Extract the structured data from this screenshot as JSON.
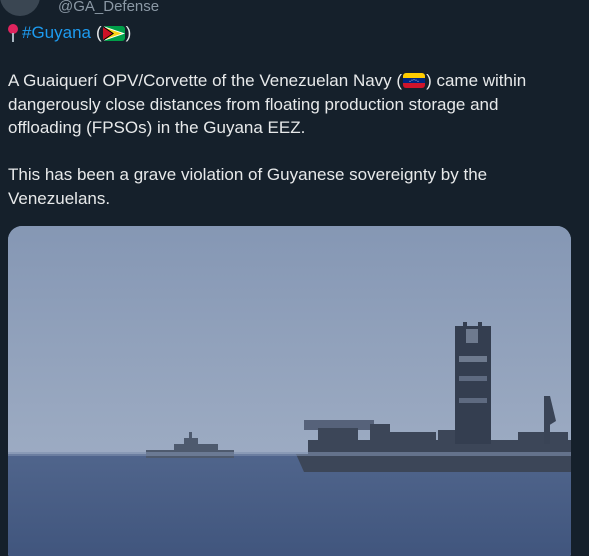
{
  "header": {
    "handle": "@GA_Defense"
  },
  "hashtag_line": {
    "hashtag": "#Guyana",
    "open_paren": "(",
    "close_paren": ")",
    "flag_icon": "guyana-flag-icon",
    "pin_icon": "round-pushpin-icon"
  },
  "body": {
    "para1_part1": "A Guaiquerí OPV/Corvette of the Venezuelan Navy (",
    "para1_part2": ") came within dangerously close distances from floating production storage and offloading (FPSOs) in the Guyana EEZ.",
    "para2": "This has been a grave violation of Guyanese sovereignty by the Venezuelans.",
    "flag_icon": "venezuela-flag-icon"
  },
  "media": {
    "kind": "video-still"
  },
  "colors": {
    "background": "#15202b",
    "text": "#e7e9ea",
    "link": "#1d9bf0",
    "muted": "#8b98a5"
  }
}
